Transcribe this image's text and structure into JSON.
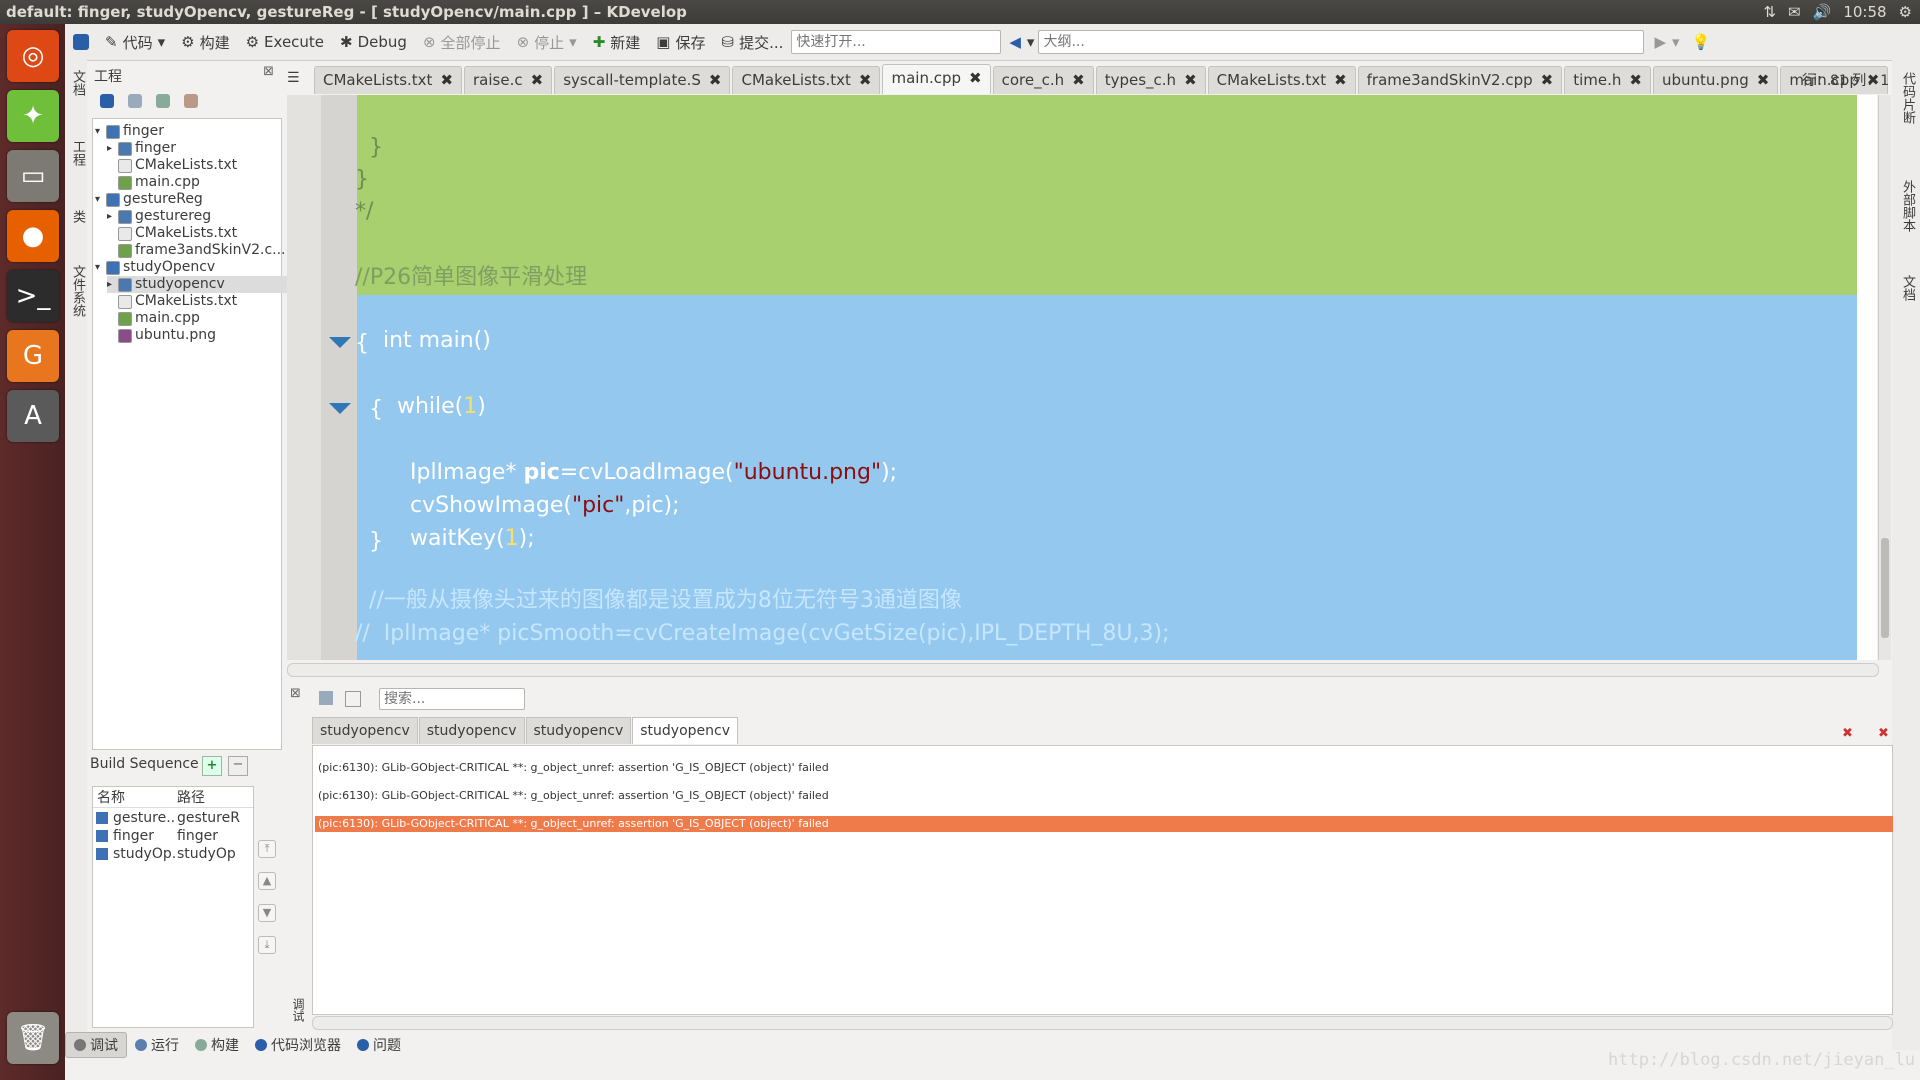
{
  "window": {
    "title": "default:  finger, studyOpencv, gestureReg - [ studyOpencv/main.cpp ] – KDevelop",
    "clock": "10:58"
  },
  "toolbar": {
    "code": "代码",
    "build": "构建",
    "execute": "Execute",
    "debug": "Debug",
    "stop_all": "全部停止",
    "stop": "停止",
    "new": "新建",
    "save": "保存",
    "commit": "提交...",
    "quick_open_placeholder": "快速打开...",
    "outline_placeholder": "大纲..."
  },
  "left_tabs": [
    "文档",
    "工程",
    "类",
    "文件系统"
  ],
  "right_tabs": [
    "代码片断",
    "外部脚本",
    "文档"
  ],
  "project": {
    "header": "工程",
    "tree": [
      {
        "label": "finger",
        "level": 0,
        "type": "folder"
      },
      {
        "label": "finger",
        "level": 1,
        "type": "target"
      },
      {
        "label": "CMakeLists.txt",
        "level": 1,
        "type": "file"
      },
      {
        "label": "main.cpp",
        "level": 1,
        "type": "cpp"
      },
      {
        "label": "gestureReg",
        "level": 0,
        "type": "folder"
      },
      {
        "label": "gesturereg",
        "level": 1,
        "type": "target"
      },
      {
        "label": "CMakeLists.txt",
        "level": 1,
        "type": "file"
      },
      {
        "label": "frame3andSkinV2.c...",
        "level": 1,
        "type": "cpp"
      },
      {
        "label": "studyOpencv",
        "level": 0,
        "type": "folder"
      },
      {
        "label": "studyopencv",
        "level": 1,
        "type": "target"
      },
      {
        "label": "CMakeLists.txt",
        "level": 1,
        "type": "file"
      },
      {
        "label": "main.cpp",
        "level": 1,
        "type": "cpp"
      },
      {
        "label": "ubuntu.png",
        "level": 1,
        "type": "image"
      }
    ]
  },
  "build_sequence": {
    "header": "Build Sequence",
    "col_name": "名称",
    "col_path": "路径",
    "rows": [
      {
        "name": "gesture...",
        "path": "gestureR"
      },
      {
        "name": "finger",
        "path": "finger"
      },
      {
        "name": "studyOp...",
        "path": "studyOp"
      }
    ]
  },
  "tabs": [
    "CMakeLists.txt",
    "raise.c",
    "syscall-template.S",
    "CMakeLists.txt",
    "main.cpp",
    "core_c.h",
    "types_c.h",
    "CMakeLists.txt",
    "frame3andSkinV2.cpp",
    "time.h",
    "ubuntu.png",
    "main.cpp"
  ],
  "cursor_position": "行：81 列：1",
  "code": {
    "l1": "}",
    "l2": "}",
    "l3": "*/",
    "l4": "//P26简单图像平滑处理",
    "l5_kw": "int",
    "l5_fn": "main()",
    "l6": "{",
    "l7_kw": "while(",
    "l7_num": "1",
    "l7_end": ")",
    "l8": "{",
    "l9_a": "IplImage* ",
    "l9_b": "pic",
    "l9_c": "=cvLoadImage(",
    "l9_str": "\"ubuntu.png\"",
    "l9_d": ");",
    "l10_a": "cvShowImage(",
    "l10_str": "\"pic\"",
    "l10_b": ",pic);",
    "l11_a": "waitKey(",
    "l11_num": "1",
    "l11_b": ");",
    "l12": "}",
    "l13": "//一般从摄像头过来的图像都是设置成为8位无符号3通道图像",
    "l14": "//  IplImage* picSmooth=cvCreateImage(cvGetSize(pic),IPL_DEPTH_8U,3);"
  },
  "output": {
    "search_placeholder": "搜索...",
    "tabs": [
      "studyopencv",
      "studyopencv",
      "studyopencv",
      "studyopencv"
    ],
    "lines": [
      "(pic:6130): GLib-GObject-CRITICAL **: g_object_unref: assertion 'G_IS_OBJECT (object)' failed",
      "(pic:6130): GLib-GObject-CRITICAL **: g_object_unref: assertion 'G_IS_OBJECT (object)' failed",
      "(pic:6130): GLib-GObject-CRITICAL **: g_object_unref: assertion 'G_IS_OBJECT (object)' failed"
    ],
    "side_label": "调试"
  },
  "bottom": {
    "debug": "调试",
    "run": "运行",
    "build": "构建",
    "code_browser": "代码浏览器",
    "problems": "问题"
  },
  "watermark": "http://blog.csdn.net/jieyan_lu",
  "colors": {
    "green_region": "#a9d06f",
    "blue_selection": "#94c8ef",
    "error_highlight": "#ef7b4b"
  }
}
